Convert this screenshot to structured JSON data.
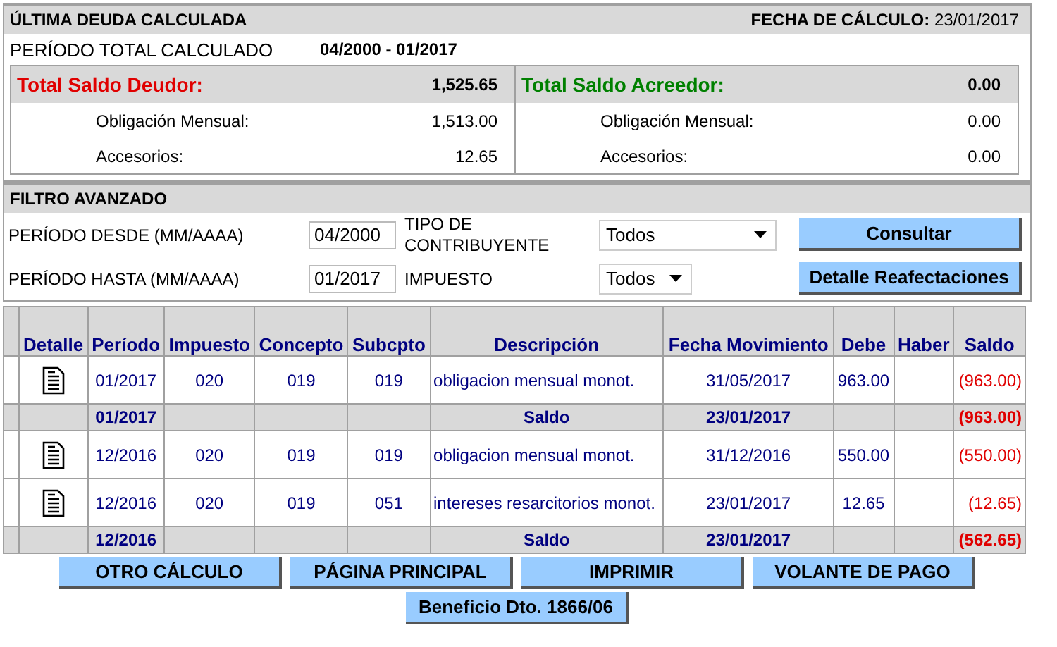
{
  "summary": {
    "title": "ÚLTIMA DEUDA CALCULADA",
    "date_label": "FECHA DE CÁLCULO:",
    "date": "23/01/2017",
    "period_label": "PERÍODO TOTAL CALCULADO",
    "period": "04/2000 - 01/2017",
    "panels": [
      {
        "kind": "debtor",
        "title": "Total Saldo Deudor:",
        "total": "1,525.65",
        "lines": [
          {
            "label": "Obligación Mensual:",
            "value": "1,513.00"
          },
          {
            "label": "Accesorios:",
            "value": "12.65"
          }
        ]
      },
      {
        "kind": "creditor",
        "title": "Total Saldo Acreedor:",
        "total": "0.00",
        "lines": [
          {
            "label": "Obligación Mensual:",
            "value": "0.00"
          },
          {
            "label": "Accesorios:",
            "value": "0.00"
          }
        ]
      }
    ]
  },
  "filter": {
    "title": "FILTRO AVANZADO",
    "from_label": "PERÍODO DESDE (MM/AAAA)",
    "from": "04/2000",
    "to_label": "PERÍODO HASTA (MM/AAAA)",
    "to": "01/2017",
    "type_label": "TIPO DE CONTRIBUYENTE",
    "type_value": "Todos",
    "tax_label": "IMPUESTO",
    "tax_value": "Todos",
    "buttons": [
      "Consultar",
      "Detalle Reafectaciones"
    ]
  },
  "table": {
    "columns": [
      "Detalle",
      "Período",
      "Impuesto",
      "Concepto",
      "Subcpto",
      "Descripción",
      "Fecha Movimiento",
      "Debe",
      "Haber",
      "Saldo"
    ],
    "rows": [
      {
        "kind": "detail",
        "periodo": "01/2017",
        "impuesto": "020",
        "concepto": "019",
        "subcpto": "019",
        "descripcion": "obligacion mensual monot.",
        "fecha": "31/05/2017",
        "debe": "963.00",
        "saldo": "(963.00)"
      },
      {
        "kind": "subtotal",
        "periodo": "01/2017",
        "descripcion": "Saldo",
        "fecha": "23/01/2017",
        "saldo": "(963.00)"
      },
      {
        "kind": "detail",
        "periodo": "12/2016",
        "impuesto": "020",
        "concepto": "019",
        "subcpto": "019",
        "descripcion": "obligacion mensual monot.",
        "fecha": "31/12/2016",
        "debe": "550.00",
        "saldo": "(550.00)"
      },
      {
        "kind": "detail",
        "periodo": "12/2016",
        "impuesto": "020",
        "concepto": "019",
        "subcpto": "051",
        "descripcion": "intereses resarcitorios monot.",
        "fecha": "23/01/2017",
        "debe": "12.65",
        "saldo": "(12.65)"
      },
      {
        "kind": "subtotal",
        "periodo": "12/2016",
        "descripcion": "Saldo",
        "fecha": "23/01/2017",
        "saldo": "(562.65)"
      }
    ]
  },
  "actions": [
    "OTRO CÁLCULO",
    "PÁGINA PRINCIPAL",
    "IMPRIMIR",
    "VOLANTE DE PAGO"
  ],
  "extra_action": "Beneficio Dto. 1866/06"
}
